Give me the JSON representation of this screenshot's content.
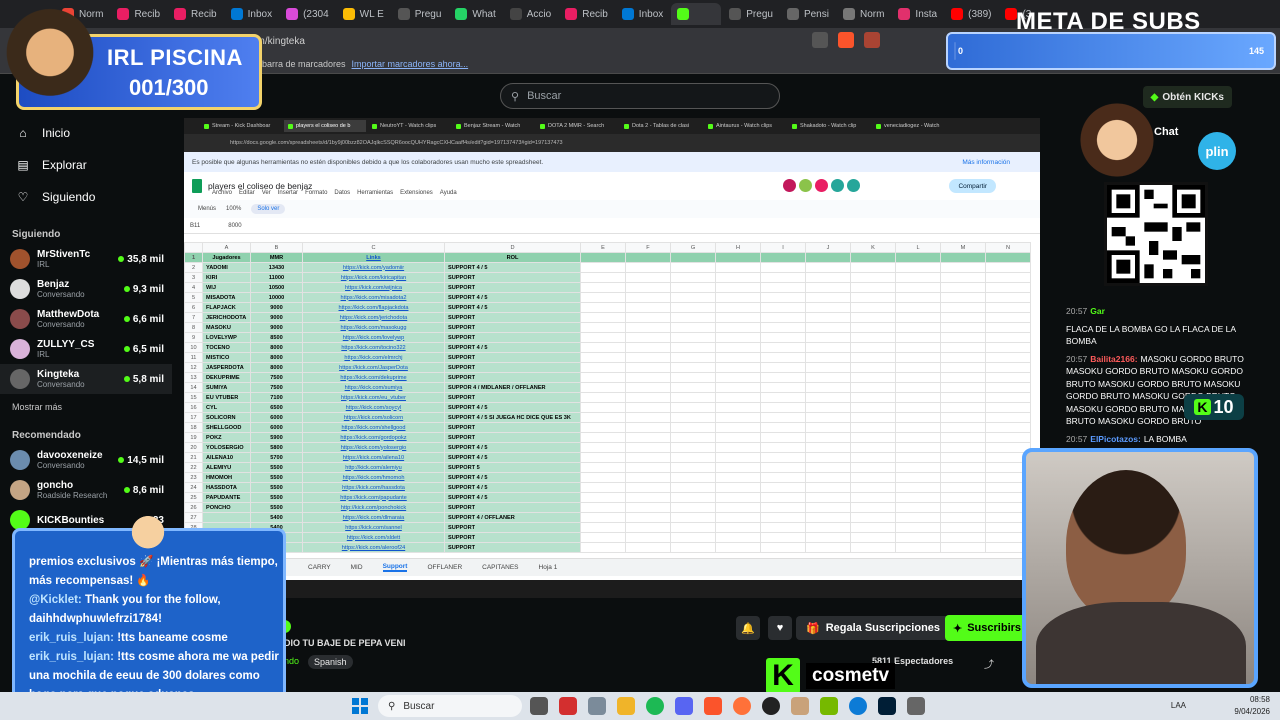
{
  "browser": {
    "tabs": [
      "Norm",
      "Recib",
      "Recib",
      "Inbox",
      "(2304",
      "WL E",
      "Pregu",
      "What",
      "Accio",
      "Recib",
      "Inbox",
      "",
      "Pregu",
      "Pensi",
      "Norm",
      "Insta",
      "(389)",
      "(3"
    ],
    "address": "kick.com/kingteka",
    "bookmarks_text": "barra de marcadores",
    "bookmarks_link": "Importar marcadores ahora..."
  },
  "kick": {
    "search_placeholder": "Buscar",
    "get_kicks": "Obtén KICKs",
    "nav": [
      {
        "label": "Inicio",
        "icon": "home-icon",
        "glyph": "⌂"
      },
      {
        "label": "Explorar",
        "icon": "compass-icon",
        "glyph": "▤"
      },
      {
        "label": "Siguiendo",
        "icon": "heart-icon",
        "glyph": "♡"
      }
    ],
    "following_header": "Siguiendo",
    "following": [
      {
        "name": "MrStivenTc",
        "status": "IRL",
        "viewers": "35,8 mil",
        "color": "#a0522d"
      },
      {
        "name": "Benjaz",
        "status": "Conversando",
        "viewers": "9,3 mil",
        "color": "#ddd"
      },
      {
        "name": "MatthewDota",
        "status": "Conversando",
        "viewers": "6,6 mil",
        "color": "#8a4b4b"
      },
      {
        "name": "ZULLYY_CS",
        "status": "IRL",
        "viewers": "6,5 mil",
        "color": "#d9b2d9"
      },
      {
        "name": "Kingteka",
        "status": "Conversando",
        "viewers": "5,8 mil",
        "color": "#666"
      }
    ],
    "show_more": "Mostrar más",
    "recommended_header": "Recomendado",
    "recommended": [
      {
        "name": "davooxeneize",
        "status": "Conversando",
        "viewers": "14,5 mil",
        "color": "#6b8cae"
      },
      {
        "name": "goncho",
        "status": "Roadside Research",
        "viewers": "8,6 mil",
        "color": "#c4a484"
      },
      {
        "name": "KICKBounties",
        "status": "",
        "viewers": "33",
        "color": "#53fc18"
      }
    ],
    "streamer": "ka",
    "stream_title": "DIO TU BAJE DE PEPA VENI",
    "category": "ndo",
    "language": "Spanish",
    "gift_label": "Regala Suscripciones",
    "subscribe_label": "Suscribirs",
    "viewers_count": "5811",
    "viewers_label": "Espectadores",
    "chat_header": "Chat",
    "chat": [
      {
        "time": "20:57",
        "user": "Gar",
        "color": "#53fc18",
        "text": ""
      },
      {
        "time": "",
        "user": "",
        "color": "#fff",
        "text": "FLACA DE LA BOMBA GO LA FLACA DE LA BOMBA"
      },
      {
        "time": "20:57",
        "user": "Bailita2166:",
        "color": "#ff5b5b",
        "text": "MASOKU GORDO BRUTO MASOKU GORDO BRUTO MASOKU GORDO BRUTO MASOKU GORDO BRUTO MASOKU GORDO BRUTO MASOKU GORDO BRUTO MASOKU GORDO BRUTO MASOKU GORDO BRUTO MASOKU GORDO BRUTO"
      },
      {
        "time": "20:57",
        "user": "ElPicotazos:",
        "color": "#5b9bff",
        "text": "LA BOMBA ZZZZZZZZZZZZZZZZ"
      }
    ]
  },
  "sheet": {
    "tabs": [
      "Stream - Kick Dashboar",
      "players el coliseo de b",
      "NeutroYT - Watch clips",
      "Benjaz Stream - Watch",
      "DOTA 2 MMR - Search",
      "Dota 2 - Tablas de clasi",
      "Aintaurus - Watch clips",
      "Shakadoto - Watch clip",
      "veneciadiogez - Watch"
    ],
    "url": "https://docs.google.com/spreadsheets/d/1by9j00bzz82OAJqlkcSSQR6oocQUHYRagcCXHCaaff4s/edit?gid=197137473#gid=197137473",
    "notice": "Es posible que algunas herramientas no estén disponibles debido a que los colaboradores usan mucho este spreadsheet.",
    "notice_link": "Más información",
    "title": "players el coliseo de benjaz",
    "menu": [
      "Archivo",
      "Editar",
      "Ver",
      "Insertar",
      "Formato",
      "Datos",
      "Herramientas",
      "Extensiones",
      "Ayuda"
    ],
    "share": "Compartir",
    "toolbar_menus": "Menús",
    "zoom": "100%",
    "view_only": "Solo ver",
    "cell_ref": "B11",
    "cell_value": "8000",
    "col_letters": [
      "A",
      "B",
      "C",
      "D",
      "E",
      "F",
      "G",
      "H",
      "I",
      "J",
      "K",
      "L",
      "M",
      "N"
    ],
    "headers": [
      "Jugadores",
      "MMR",
      "Links",
      "ROL"
    ],
    "rows": [
      [
        "YADOMI",
        "13430",
        "https://kick.com/yadomiir",
        "SUPPORT 4 / 5"
      ],
      [
        "KIRI",
        "11000",
        "https://kick.com/kiricapitan",
        "SUPPORT"
      ],
      [
        "WIJ",
        "10500",
        "https://kick.com/wijnica",
        "SUPPORT"
      ],
      [
        "MISADOTA",
        "10000",
        "https://kick.com/misadota2",
        "SUPPORT 4 / 5"
      ],
      [
        "FLAPJACK",
        "9000",
        "https://kick.com/flapjackdota",
        "SUPPORT 4 / 5"
      ],
      [
        "JERICHODOTA",
        "9000",
        "https://kick.com/jerichodota",
        "SUPPORT"
      ],
      [
        "MASOKU",
        "9000",
        "https://kick.com/masokugg",
        "SUPPORT"
      ],
      [
        "LOVELYWP",
        "8500",
        "https://kick.com/lovelywp",
        "SUPPORT"
      ],
      [
        "TOCENO",
        "8000",
        "https://kick.com/tocino322",
        "SUPPORT 4 / 5"
      ],
      [
        "MISTICO",
        "8000",
        "https://kick.com/elmrchj",
        "SUPPORT"
      ],
      [
        "JASPERDOTA",
        "8000",
        "https://kick.com/JasperDota",
        "SUPPORT"
      ],
      [
        "DEKUPRIME",
        "7500",
        "https://kick.com/dekuprime",
        "SUPPORT"
      ],
      [
        "SUMIYA",
        "7500",
        "https://kick.com/sumiya",
        "SUPPOR 4 / MIDLANER / OFFLANER"
      ],
      [
        "EU VTUBER",
        "7100",
        "https://kick.com/eu_vtuber",
        "SUPPORT"
      ],
      [
        "CYL",
        "6500",
        "https://kick.com/soycyl",
        "SUPPORT 4 / 5"
      ],
      [
        "SOLICORN",
        "6000",
        "https://kick.com/solicorn",
        "SUPPORT 4 / 5 SI JUEGA HC DICE QUE ES 3K"
      ],
      [
        "SHELLGOOD",
        "6000",
        "https://kick.com/shellgood",
        "SUPPORT"
      ],
      [
        "POKZ",
        "5900",
        "https://kick.com/gordopokz",
        "SUPPORT"
      ],
      [
        "YOLOSERGIO",
        "5800",
        "https://kick.com/yolosergio",
        "SUPPORT 4 / 5"
      ],
      [
        "AILENA10",
        "5700",
        "https://kick.com/ailena10",
        "SUPPORT 4 / 5"
      ],
      [
        "ALEMIYU",
        "5500",
        "http://kick.com/alemiyu",
        "SUPPORT 5"
      ],
      [
        "HMOMOH",
        "5500",
        "https://kick.com/hmomoh",
        "SUPPORT 4 / 5"
      ],
      [
        "HASSDOTA",
        "5500",
        "https://kick.com/hassdota",
        "SUPPORT 4 / 5"
      ],
      [
        "PAPUDANTE",
        "5500",
        "https://kick.com/papudante",
        "SUPPORT 4 / 5"
      ],
      [
        "PONCHO",
        "5500",
        "http://kick.com/ponchokick",
        "SUPPORT"
      ],
      [
        "",
        "5400",
        "https://kick.com/dlmaraia",
        "SUPPORT 4 / OFFLANER"
      ],
      [
        "",
        "5400",
        "https://kick.com/sannel",
        "SUPPORT"
      ],
      [
        "",
        "5400",
        "https://kick.com/sldett",
        "SUPPORT"
      ],
      [
        "",
        "5400",
        "https://kick.com/aleroof24",
        "SUPPORT"
      ]
    ],
    "sheet_tabs": [
      "CARRY",
      "MID",
      "Support",
      "OFFLANER",
      "CAPITANES",
      "Hoja 1"
    ],
    "active_sheet": "Support"
  },
  "overlays": {
    "piscina_line1": "IRL PISCINA",
    "piscina_line2": "001/300",
    "meta_title": "META DE SUBS",
    "meta_left": "0",
    "meta_right": "145",
    "meta_progress": 0,
    "plin": "plin",
    "k10": "10",
    "cosme": "cosmetv",
    "chatbox": [
      {
        "user": "",
        "text": "premios exclusivos 🚀 ¡Mientras más tiempo, más recompensas! 🔥"
      },
      {
        "user": "@Kicklet:",
        "text": "Thank you for the follow, daihhdwphuwlefrzi1784!"
      },
      {
        "user": "erik_ruis_lujan:",
        "text": "!tts baneame cosme"
      },
      {
        "user": "erik_ruis_lujan:",
        "text": "!tts cosme ahora me wa pedir una mochila de eeuu de 300 dolares como hago para que pague aduanas"
      }
    ]
  },
  "taskbar": {
    "search": "Buscar",
    "lang": "LAA",
    "time": "08:58",
    "date": "9/04/2026"
  }
}
